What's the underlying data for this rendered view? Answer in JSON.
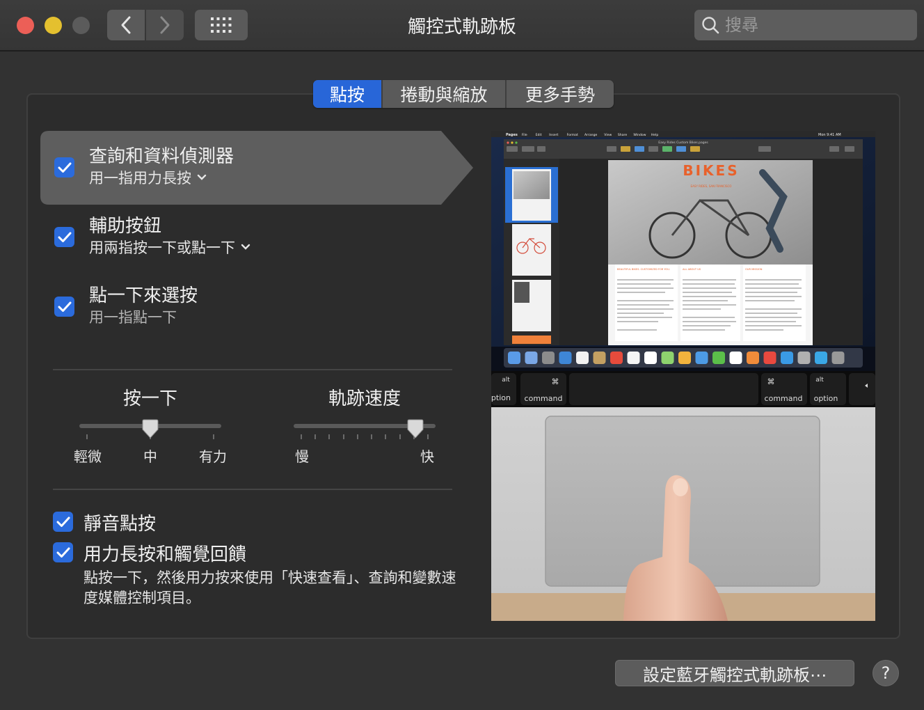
{
  "window": {
    "title": "觸控式軌跡板"
  },
  "search": {
    "placeholder": "搜尋"
  },
  "tabs": [
    {
      "label": "點按",
      "active": true
    },
    {
      "label": "捲動與縮放",
      "active": false
    },
    {
      "label": "更多手勢",
      "active": false
    }
  ],
  "options": [
    {
      "title": "查詢和資料偵測器",
      "subtitle": "用一指用力長按",
      "checked": true,
      "has_menu": true
    },
    {
      "title": "輔助按鈕",
      "subtitle": "用兩指按一下或點一下",
      "checked": true,
      "has_menu": true
    },
    {
      "title": "點一下來選按",
      "subtitle": "用一指點一下",
      "checked": true,
      "has_menu": false
    }
  ],
  "click_slider": {
    "title": "按一下",
    "labels": [
      "輕微",
      "中",
      "有力"
    ],
    "value_index": 1
  },
  "tracking_slider": {
    "title": "軌跡速度",
    "min_label": "慢",
    "max_label": "快",
    "value_fraction": 0.86
  },
  "silent_click": {
    "label": "靜音點按",
    "checked": true
  },
  "force_click": {
    "label": "用力長按和觸覺回饋",
    "checked": true,
    "description": "點按一下，然後用力按來使用「快速查看」、查詢和變數速度媒體控制項目。"
  },
  "preview": {
    "app_name": "Pages",
    "menu_items": [
      "File",
      "Edit",
      "Insert",
      "Format",
      "Arrange",
      "View",
      "Share",
      "Window",
      "Help"
    ],
    "clock": "Mon 9:41 AM",
    "doc_title": "Easy Rides Custom Bikes.pages",
    "doc_heading": "BIKES",
    "doc_subheading": "EASY RIDES, SAN FRANCISCO",
    "col_titles": [
      "BEAUTIFUL BIKES. CUSTOMIZED FOR YOU.",
      "ALL ABOUT US",
      "OUR MISSION"
    ],
    "touchbar_keys": [
      "option",
      "command",
      "command",
      "option"
    ],
    "touchbar_small": [
      "alt",
      "⌘",
      "⌘",
      "alt"
    ]
  },
  "bottom": {
    "bluetooth_button": "設定藍牙觸控式軌跡板⋯",
    "help": "?"
  },
  "colors": {
    "accent": "#2866d8",
    "background": "#323232",
    "panel": "#2c2c2c"
  }
}
